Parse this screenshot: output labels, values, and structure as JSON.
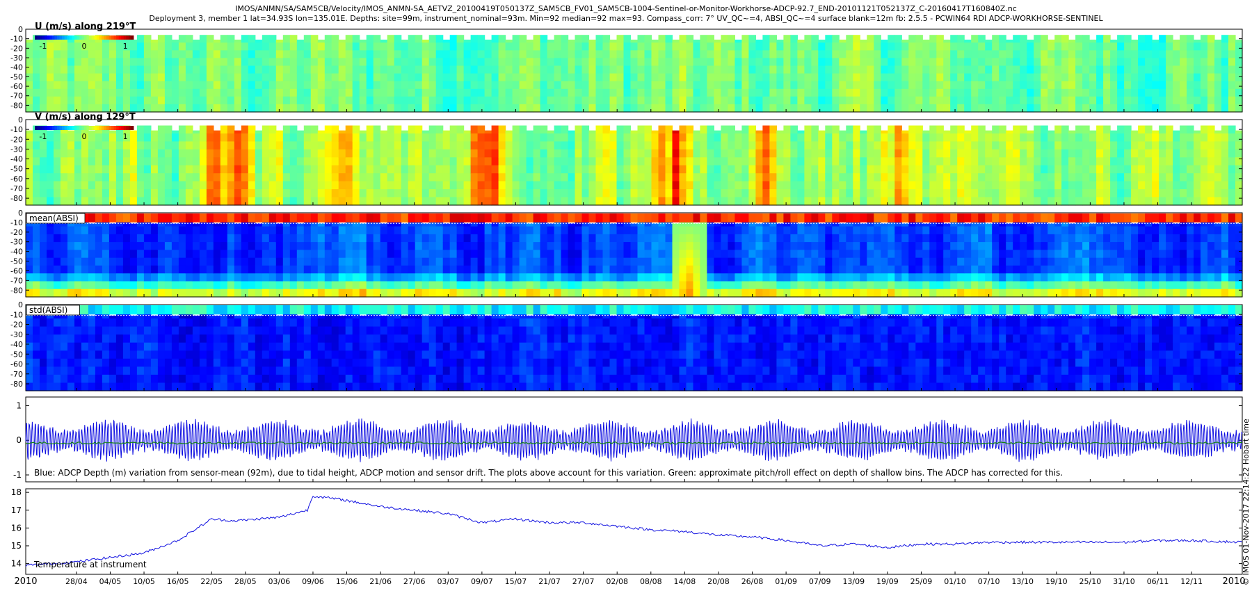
{
  "header": {
    "line1": "IMOS/ANMN/SA/SAM5CB/Velocity/IMOS_ANMN-SA_AETVZ_20100419T050137Z_SAM5CB_FV01_SAM5CB-1004-Sentinel-or-Monitor-Workhorse-ADCP-92.7_END-20101121T052137Z_C-20160417T160840Z.nc",
    "line2": "Deployment 3, member 1 lat=34.93S lon=135.01E. Depths: site=99m, instrument_nominal=93m. Min=92 median=92 max=93. Compass_corr: 7° UV_QC~=4, ABSI_QC~=4 surface blank=12m fb: 2.5.5 - PCWIN64 RDI ADCP-WORKHORSE-SENTINEL"
  },
  "side_stamp": "© IMOS 01-Nov-2017 22:14:22 Hobart time",
  "colors": {
    "depth_line": "#1010e0",
    "pitch_roll_line": "#108010",
    "temperature_line": "#1010e0"
  },
  "colormap": "jet",
  "chart_data": [
    {
      "id": "u",
      "type": "heatmap",
      "title": "U (m/s) along 219°T",
      "ylabel": "",
      "yticks": [
        0,
        -10,
        -20,
        -30,
        -40,
        -50,
        -60,
        -70,
        -80
      ],
      "ylim": [
        -87,
        0
      ],
      "colorbar": {
        "ticks": [
          "-1",
          "0",
          "1"
        ],
        "range": [
          -1.2,
          1.2
        ]
      },
      "mean_value": -0.05,
      "noise": 0.28,
      "bands": []
    },
    {
      "id": "v",
      "type": "heatmap",
      "title": "V (m/s) along 129°T",
      "ylabel": "",
      "yticks": [
        0,
        -10,
        -20,
        -30,
        -40,
        -50,
        -60,
        -70,
        -80
      ],
      "ylim": [
        -87,
        0
      ],
      "colorbar": {
        "ticks": [
          "-1",
          "0",
          "1"
        ],
        "range": [
          -1.2,
          1.2
        ]
      },
      "mean_value": 0.05,
      "noise": 0.3,
      "bands": [
        {
          "date": "2010-05-22",
          "value": 0.8
        },
        {
          "date": "2010-05-26",
          "value": 0.7
        },
        {
          "date": "2010-06-14",
          "value": 0.45
        },
        {
          "date": "2010-07-08",
          "value": 0.85
        },
        {
          "date": "2010-07-10",
          "value": 0.8
        },
        {
          "date": "2010-07-30",
          "value": 0.5
        },
        {
          "date": "2010-08-09",
          "value": 0.75
        },
        {
          "date": "2010-08-12",
          "value": 0.85
        },
        {
          "date": "2010-08-28",
          "value": 0.45
        },
        {
          "date": "2010-09-20",
          "value": 0.4
        },
        {
          "date": "2010-10-10",
          "value": 0.35
        },
        {
          "date": "2010-11-03",
          "value": 0.3
        }
      ]
    },
    {
      "id": "mean_absi",
      "type": "heatmap",
      "title": "mean(ABSI)",
      "ylabel": "",
      "yticks": [
        0,
        -10,
        -20,
        -30,
        -40,
        -50,
        -60,
        -70,
        -80
      ],
      "ylim": [
        -87,
        0
      ],
      "surface_value": 0.8,
      "bottom_value": 0.3,
      "interior_value": -0.75,
      "noise": 0.25,
      "bands": [
        {
          "date": "2010-08-14",
          "value": 0.6
        }
      ]
    },
    {
      "id": "std_absi",
      "type": "heatmap",
      "title": "std(ABSI)",
      "ylabel": "",
      "yticks": [
        0,
        -10,
        -20,
        -30,
        -40,
        -50,
        -60,
        -70,
        -80
      ],
      "ylim": [
        -87,
        0
      ],
      "surface_value": -0.3,
      "interior_value": -0.85,
      "noise": 0.18,
      "bands": []
    },
    {
      "id": "depth_variation",
      "type": "line",
      "title": "",
      "caption": "Blue: ADCP Depth (m) variation from sensor-mean (92m), due to tidal height, ADCP motion and sensor drift. The plots above account for this variation. Green: approximate pitch/roll effect on depth of shallow bins. The ADCP has corrected for this.",
      "yticks": [
        1,
        0,
        -1
      ],
      "ylim": [
        -1.2,
        1.25
      ],
      "series": [
        {
          "kind": "tidal",
          "amplitude_min": 0.25,
          "amplitude_max": 0.55,
          "offset": 0.0
        },
        {
          "kind": "pitch_roll",
          "offset": -0.08
        }
      ]
    },
    {
      "id": "temperature",
      "type": "line",
      "title": "",
      "caption": "Temperature at instrument",
      "yticks": [
        18,
        17,
        16,
        15,
        14
      ],
      "ylim": [
        13.4,
        18.2
      ],
      "x": [
        "2010-04-19",
        "2010-04-28",
        "2010-05-10",
        "2010-05-16",
        "2010-05-22",
        "2010-05-26",
        "2010-06-03",
        "2010-06-08",
        "2010-06-09",
        "2010-06-14",
        "2010-06-21",
        "2010-06-27",
        "2010-07-03",
        "2010-07-09",
        "2010-07-15",
        "2010-07-21",
        "2010-07-27",
        "2010-08-02",
        "2010-08-08",
        "2010-08-14",
        "2010-08-20",
        "2010-08-26",
        "2010-09-01",
        "2010-09-07",
        "2010-09-13",
        "2010-09-19",
        "2010-09-25",
        "2010-10-01",
        "2010-10-07",
        "2010-10-13",
        "2010-10-19",
        "2010-10-25",
        "2010-10-31",
        "2010-11-06",
        "2010-11-12",
        "2010-11-21"
      ],
      "y": [
        13.9,
        14.1,
        14.6,
        15.3,
        16.5,
        16.4,
        16.6,
        17.0,
        17.8,
        17.6,
        17.2,
        17.0,
        16.8,
        16.3,
        16.5,
        16.3,
        16.3,
        16.1,
        15.9,
        15.8,
        15.6,
        15.5,
        15.3,
        15.0,
        15.1,
        14.9,
        15.1,
        15.1,
        15.2,
        15.2,
        15.2,
        15.2,
        15.2,
        15.3,
        15.3,
        15.2
      ]
    }
  ],
  "x_axis": {
    "start": "2010-04-19",
    "end": "2010-11-21",
    "year_label": "2010",
    "end_year_label": "2010",
    "tick_labels": [
      "28/04",
      "04/05",
      "10/05",
      "16/05",
      "22/05",
      "28/05",
      "03/06",
      "09/06",
      "15/06",
      "21/06",
      "27/06",
      "03/07",
      "09/07",
      "15/07",
      "21/07",
      "27/07",
      "02/08",
      "08/08",
      "14/08",
      "20/08",
      "26/08",
      "01/09",
      "07/09",
      "13/09",
      "19/09",
      "25/09",
      "01/10",
      "07/10",
      "13/10",
      "19/10",
      "25/10",
      "31/10",
      "06/11",
      "12/11"
    ]
  }
}
